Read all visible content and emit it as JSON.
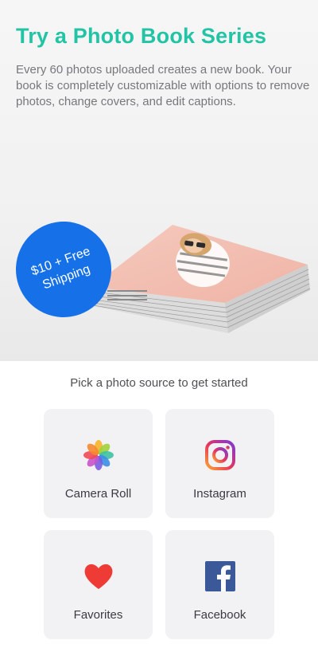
{
  "hero": {
    "title": "Try a Photo Book Series",
    "description": "Every 60 photos uploaded creates a new book. Your book is completely customizable with options to remove photos, change covers, and edit captions.",
    "badge_text": "$10 + Free Shipping",
    "colors": {
      "title": "#23c4a6",
      "badge": "#1671e8"
    }
  },
  "picker": {
    "prompt": "Pick a photo source to get started",
    "sources": [
      {
        "label": "Camera Roll",
        "icon": "photos-flower-icon"
      },
      {
        "label": "Instagram",
        "icon": "instagram-icon"
      },
      {
        "label": "Favorites",
        "icon": "heart-icon"
      },
      {
        "label": "Facebook",
        "icon": "facebook-icon"
      }
    ]
  }
}
